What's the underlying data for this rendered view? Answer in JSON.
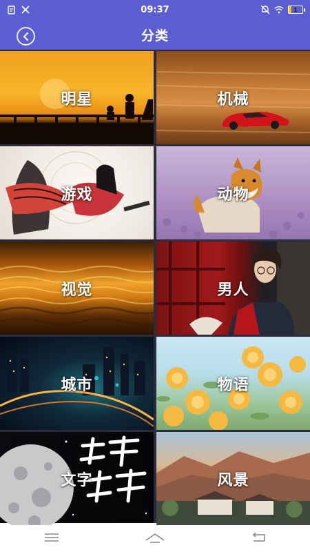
{
  "status_bar": {
    "time": "09:37",
    "battery_level": "1",
    "left_icons": [
      "notification-file-icon",
      "tools-icon"
    ],
    "right_icons": [
      "mute-bell-icon",
      "wifi-icon",
      "battery-icon"
    ]
  },
  "app_bar": {
    "title": "分类",
    "back_icon": "back-arrow-icon"
  },
  "categories": [
    {
      "label": "明星"
    },
    {
      "label": "机械"
    },
    {
      "label": "游戏"
    },
    {
      "label": "动物"
    },
    {
      "label": "视觉"
    },
    {
      "label": "男人"
    },
    {
      "label": "城市"
    },
    {
      "label": "物语"
    },
    {
      "label": "文字"
    },
    {
      "label": "风景"
    }
  ],
  "nav_bar": {
    "buttons": [
      "menu-icon",
      "home-icon",
      "back-icon"
    ]
  },
  "colors": {
    "primary": "#5a5ed2",
    "grid_background": "#2a2b3d"
  }
}
